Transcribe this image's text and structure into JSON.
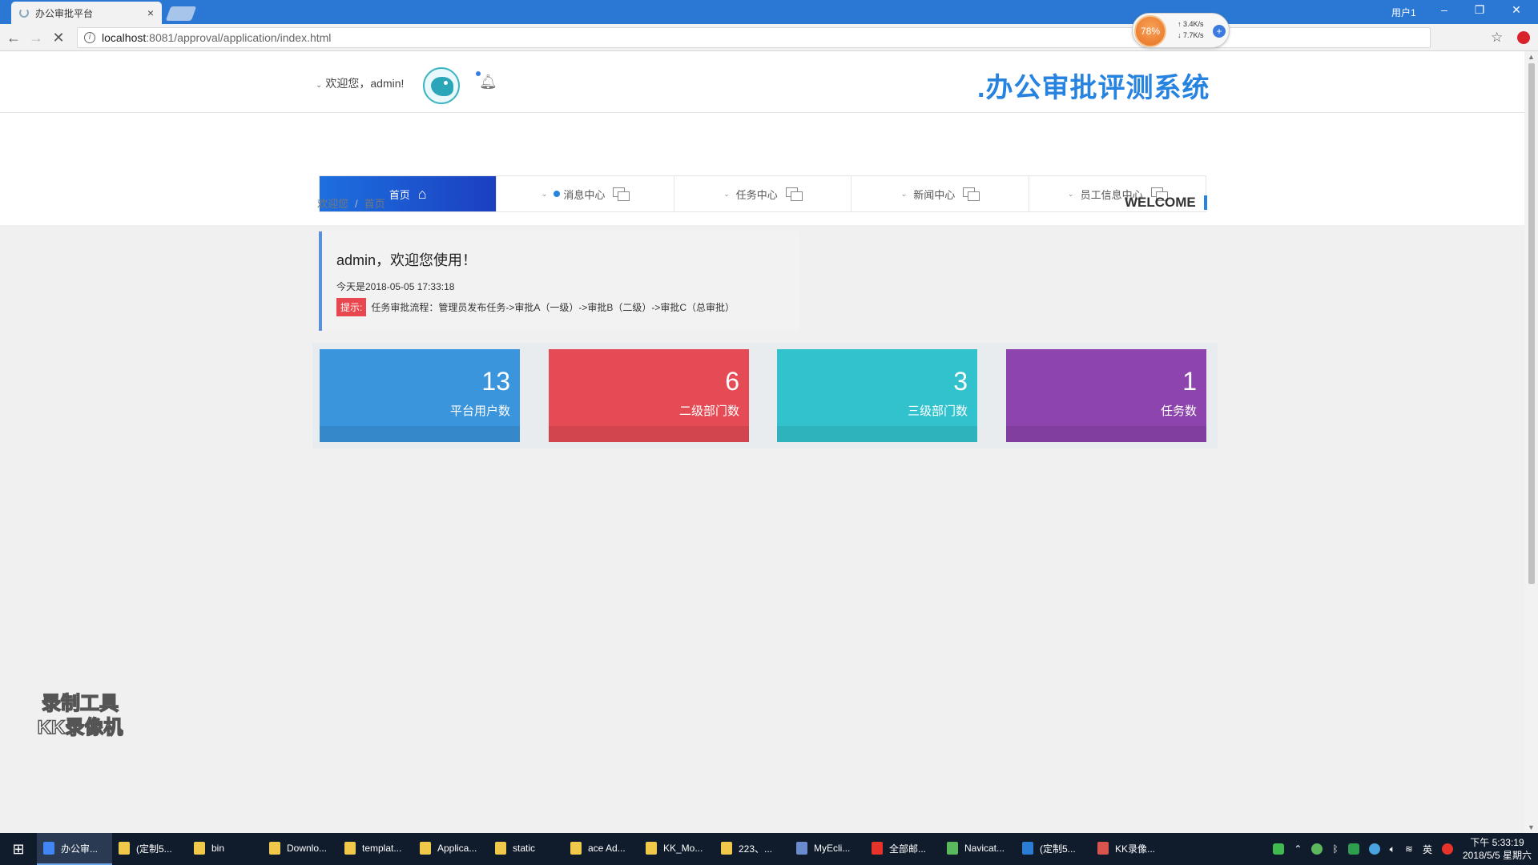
{
  "browser": {
    "tab_title": "办公审批平台",
    "tab_close": "×",
    "user_label": "用户1",
    "window_controls": {
      "minimize": "–",
      "restore": "❐",
      "close": "✕"
    },
    "url_host": "localhost",
    "url_rest": ":8081/approval/application/index.html",
    "net_widget": {
      "percent": "78%",
      "up": "3.4K/s",
      "down": "7.7K/s",
      "plus": "+"
    }
  },
  "header": {
    "welcome": "欢迎您，admin!",
    "site_title": ".办公审批评测系统"
  },
  "nav": {
    "items": [
      {
        "label": "首页",
        "active": true
      },
      {
        "label": "消息中心",
        "active": false
      },
      {
        "label": "任务中心",
        "active": false
      },
      {
        "label": "新闻中心",
        "active": false
      },
      {
        "label": "员工信息中心",
        "active": false
      }
    ]
  },
  "breadcrumb": {
    "root": "欢迎您",
    "sep": "/",
    "current": "首页"
  },
  "welcome_tag": "WELCOME",
  "notice": {
    "title": "admin，欢迎您使用！",
    "date": "今天是2018-05-05 17:33:18",
    "tip_badge": "提示:",
    "tip_text": "任务审批流程：管理员发布任务->审批A（一级）->审批B（二级）->审批C（总审批）"
  },
  "stats": [
    {
      "value": "13",
      "label": "平台用户数",
      "color": "#3a95dc"
    },
    {
      "value": "6",
      "label": "二级部门数",
      "color": "#e54b55"
    },
    {
      "value": "3",
      "label": "三级部门数",
      "color": "#32c2cd"
    },
    {
      "value": "1",
      "label": "任务数",
      "color": "#8e44ad"
    }
  ],
  "watermark": {
    "line1": "录制工具",
    "line2": "KK录像机"
  },
  "taskbar": {
    "items": [
      {
        "label": "办公审...",
        "color": "#4285f4",
        "active": true
      },
      {
        "label": "(定制5...",
        "color": "#f1c94a",
        "active": false
      },
      {
        "label": "bin",
        "color": "#f1c94a",
        "active": false
      },
      {
        "label": "Downlo...",
        "color": "#f1c94a",
        "active": false
      },
      {
        "label": "templat...",
        "color": "#f1c94a",
        "active": false
      },
      {
        "label": "Applica...",
        "color": "#f1c94a",
        "active": false
      },
      {
        "label": "static",
        "color": "#f1c94a",
        "active": false
      },
      {
        "label": "ace Ad...",
        "color": "#f1c94a",
        "active": false
      },
      {
        "label": "KK_Mo...",
        "color": "#f1c94a",
        "active": false
      },
      {
        "label": "223、...",
        "color": "#f1c94a",
        "active": false
      },
      {
        "label": "MyEcli...",
        "color": "#6a8ccf",
        "active": false
      },
      {
        "label": "全部邮...",
        "color": "#e8332a",
        "active": false
      },
      {
        "label": "Navicat...",
        "color": "#5cb85c",
        "active": false
      },
      {
        "label": "(定制5...",
        "color": "#2b7cd3",
        "active": false
      },
      {
        "label": "KK录像...",
        "color": "#d9534f",
        "active": false
      }
    ],
    "ime": "英",
    "time": "下午 5:33:19",
    "date": "2018/5/5 星期六"
  }
}
